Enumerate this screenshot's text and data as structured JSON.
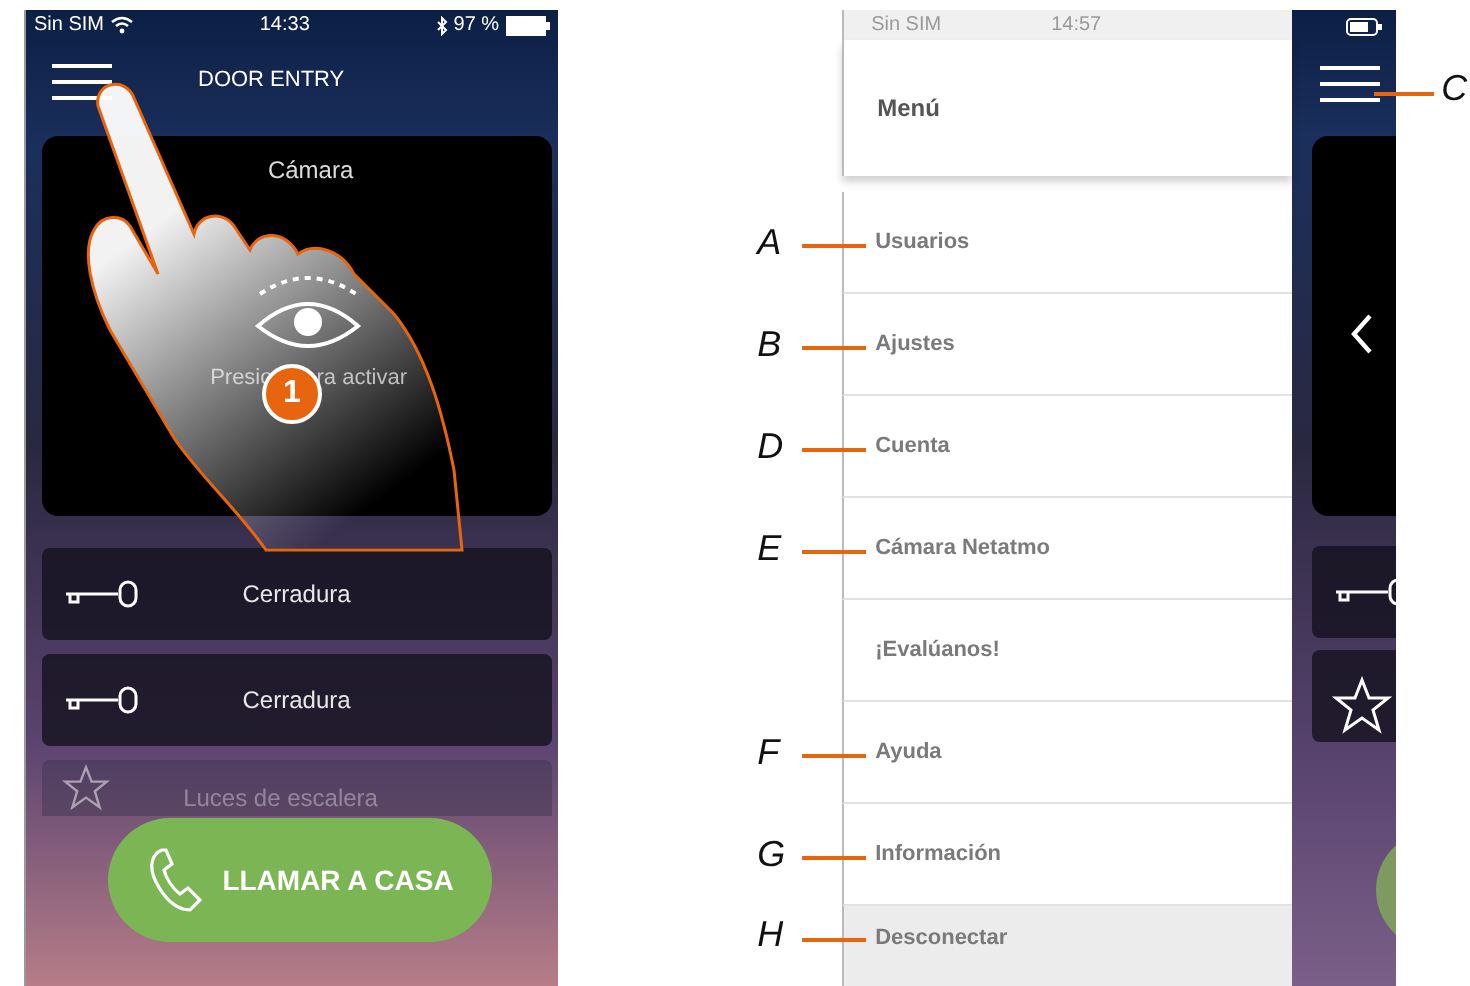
{
  "home_screen": {
    "status_bar": {
      "carrier": "Sin SIM",
      "time": "14:33",
      "battery": "97 %"
    },
    "header": {
      "title": "DOOR ENTRY"
    },
    "camera": {
      "title": "Cámara",
      "prompt_start": "Presio",
      "prompt_end": "ra activar"
    },
    "rows": [
      {
        "label": "Cerradura",
        "kind": "lock",
        "disabled": false
      },
      {
        "label": "Cerradura",
        "kind": "lock",
        "disabled": false
      },
      {
        "label": "Luces de escalera",
        "kind": "light",
        "disabled": true
      }
    ],
    "call_button": {
      "label": "LLAMAR A CASA"
    },
    "step_badge": "1"
  },
  "menu_screen": {
    "status_bar": {
      "carrier": "Sin SIM",
      "time": "14:57"
    },
    "title": "Menú",
    "items": [
      {
        "label": "Usuarios",
        "callout": "A",
        "highlighted": false
      },
      {
        "label": "Ajustes",
        "callout": "B",
        "highlighted": false
      },
      {
        "label": "Cuenta",
        "callout": "D",
        "highlighted": false
      },
      {
        "label": "Cámara Netatmo",
        "callout": "E",
        "highlighted": false
      },
      {
        "label": "¡Evalúanos!",
        "highlighted": false
      },
      {
        "label": "Ayuda",
        "callout": "F",
        "highlighted": false
      },
      {
        "label": "Información",
        "callout": "G",
        "highlighted": false
      },
      {
        "label": "Desconectar",
        "callout": "H",
        "highlighted": true
      }
    ],
    "menu_button_callout": "C"
  }
}
